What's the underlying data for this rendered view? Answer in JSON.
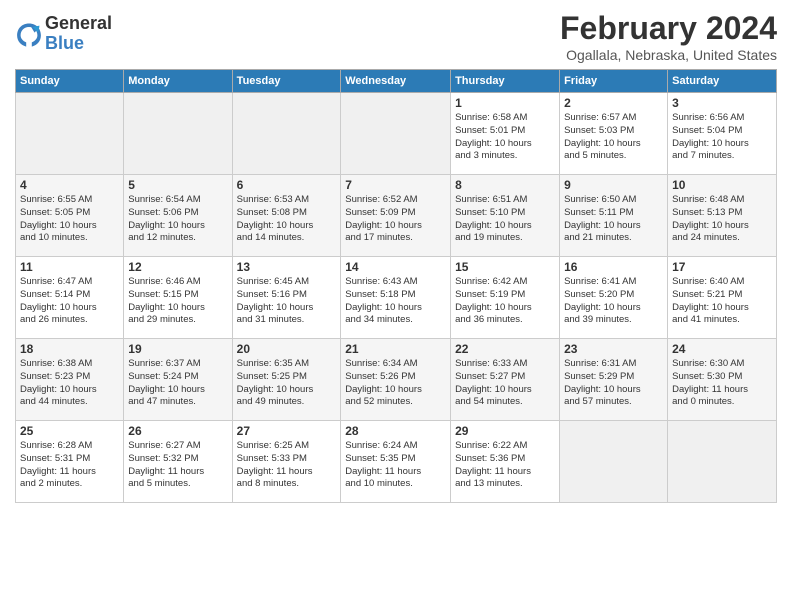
{
  "logo": {
    "line1": "General",
    "line2": "Blue"
  },
  "title": "February 2024",
  "subtitle": "Ogallala, Nebraska, United States",
  "days_of_week": [
    "Sunday",
    "Monday",
    "Tuesday",
    "Wednesday",
    "Thursday",
    "Friday",
    "Saturday"
  ],
  "weeks": [
    [
      {
        "num": "",
        "detail": ""
      },
      {
        "num": "",
        "detail": ""
      },
      {
        "num": "",
        "detail": ""
      },
      {
        "num": "",
        "detail": ""
      },
      {
        "num": "1",
        "detail": "Sunrise: 6:58 AM\nSunset: 5:01 PM\nDaylight: 10 hours\nand 3 minutes."
      },
      {
        "num": "2",
        "detail": "Sunrise: 6:57 AM\nSunset: 5:03 PM\nDaylight: 10 hours\nand 5 minutes."
      },
      {
        "num": "3",
        "detail": "Sunrise: 6:56 AM\nSunset: 5:04 PM\nDaylight: 10 hours\nand 7 minutes."
      }
    ],
    [
      {
        "num": "4",
        "detail": "Sunrise: 6:55 AM\nSunset: 5:05 PM\nDaylight: 10 hours\nand 10 minutes."
      },
      {
        "num": "5",
        "detail": "Sunrise: 6:54 AM\nSunset: 5:06 PM\nDaylight: 10 hours\nand 12 minutes."
      },
      {
        "num": "6",
        "detail": "Sunrise: 6:53 AM\nSunset: 5:08 PM\nDaylight: 10 hours\nand 14 minutes."
      },
      {
        "num": "7",
        "detail": "Sunrise: 6:52 AM\nSunset: 5:09 PM\nDaylight: 10 hours\nand 17 minutes."
      },
      {
        "num": "8",
        "detail": "Sunrise: 6:51 AM\nSunset: 5:10 PM\nDaylight: 10 hours\nand 19 minutes."
      },
      {
        "num": "9",
        "detail": "Sunrise: 6:50 AM\nSunset: 5:11 PM\nDaylight: 10 hours\nand 21 minutes."
      },
      {
        "num": "10",
        "detail": "Sunrise: 6:48 AM\nSunset: 5:13 PM\nDaylight: 10 hours\nand 24 minutes."
      }
    ],
    [
      {
        "num": "11",
        "detail": "Sunrise: 6:47 AM\nSunset: 5:14 PM\nDaylight: 10 hours\nand 26 minutes."
      },
      {
        "num": "12",
        "detail": "Sunrise: 6:46 AM\nSunset: 5:15 PM\nDaylight: 10 hours\nand 29 minutes."
      },
      {
        "num": "13",
        "detail": "Sunrise: 6:45 AM\nSunset: 5:16 PM\nDaylight: 10 hours\nand 31 minutes."
      },
      {
        "num": "14",
        "detail": "Sunrise: 6:43 AM\nSunset: 5:18 PM\nDaylight: 10 hours\nand 34 minutes."
      },
      {
        "num": "15",
        "detail": "Sunrise: 6:42 AM\nSunset: 5:19 PM\nDaylight: 10 hours\nand 36 minutes."
      },
      {
        "num": "16",
        "detail": "Sunrise: 6:41 AM\nSunset: 5:20 PM\nDaylight: 10 hours\nand 39 minutes."
      },
      {
        "num": "17",
        "detail": "Sunrise: 6:40 AM\nSunset: 5:21 PM\nDaylight: 10 hours\nand 41 minutes."
      }
    ],
    [
      {
        "num": "18",
        "detail": "Sunrise: 6:38 AM\nSunset: 5:23 PM\nDaylight: 10 hours\nand 44 minutes."
      },
      {
        "num": "19",
        "detail": "Sunrise: 6:37 AM\nSunset: 5:24 PM\nDaylight: 10 hours\nand 47 minutes."
      },
      {
        "num": "20",
        "detail": "Sunrise: 6:35 AM\nSunset: 5:25 PM\nDaylight: 10 hours\nand 49 minutes."
      },
      {
        "num": "21",
        "detail": "Sunrise: 6:34 AM\nSunset: 5:26 PM\nDaylight: 10 hours\nand 52 minutes."
      },
      {
        "num": "22",
        "detail": "Sunrise: 6:33 AM\nSunset: 5:27 PM\nDaylight: 10 hours\nand 54 minutes."
      },
      {
        "num": "23",
        "detail": "Sunrise: 6:31 AM\nSunset: 5:29 PM\nDaylight: 10 hours\nand 57 minutes."
      },
      {
        "num": "24",
        "detail": "Sunrise: 6:30 AM\nSunset: 5:30 PM\nDaylight: 11 hours\nand 0 minutes."
      }
    ],
    [
      {
        "num": "25",
        "detail": "Sunrise: 6:28 AM\nSunset: 5:31 PM\nDaylight: 11 hours\nand 2 minutes."
      },
      {
        "num": "26",
        "detail": "Sunrise: 6:27 AM\nSunset: 5:32 PM\nDaylight: 11 hours\nand 5 minutes."
      },
      {
        "num": "27",
        "detail": "Sunrise: 6:25 AM\nSunset: 5:33 PM\nDaylight: 11 hours\nand 8 minutes."
      },
      {
        "num": "28",
        "detail": "Sunrise: 6:24 AM\nSunset: 5:35 PM\nDaylight: 11 hours\nand 10 minutes."
      },
      {
        "num": "29",
        "detail": "Sunrise: 6:22 AM\nSunset: 5:36 PM\nDaylight: 11 hours\nand 13 minutes."
      },
      {
        "num": "",
        "detail": ""
      },
      {
        "num": "",
        "detail": ""
      }
    ]
  ]
}
